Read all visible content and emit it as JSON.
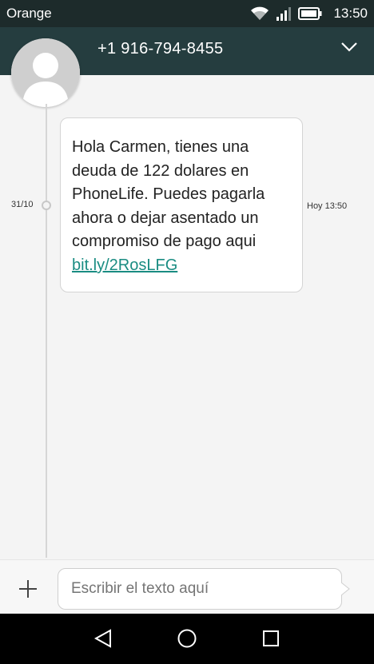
{
  "status_bar": {
    "carrier": "Orange",
    "time": "13:50",
    "icons": [
      "wifi-icon",
      "signal-icon",
      "battery-icon"
    ]
  },
  "header": {
    "contact": "+1 916-794-8455",
    "menu_icon": "chevron-down-icon"
  },
  "conversation": {
    "date_label": "31/10",
    "messages": [
      {
        "text": "Hola Carmen, tienes una\ndeuda de 122 dolares en\nPhoneLife. Puedes pagarla\nahora o dejar asentado un\ncompromiso de pago aqui",
        "link": "bit.ly/2RosLFG",
        "time": "Hoy 13:50"
      }
    ]
  },
  "composer": {
    "placeholder": "Escribir el texto aquí",
    "add_icon": "plus-icon"
  },
  "nav_bar": {
    "icons": [
      "back-icon",
      "home-icon",
      "recents-icon"
    ]
  },
  "colors": {
    "status_bar": "#1d2b2b",
    "header": "#253d3f",
    "link": "#1a8c82",
    "background": "#f4f4f4"
  }
}
